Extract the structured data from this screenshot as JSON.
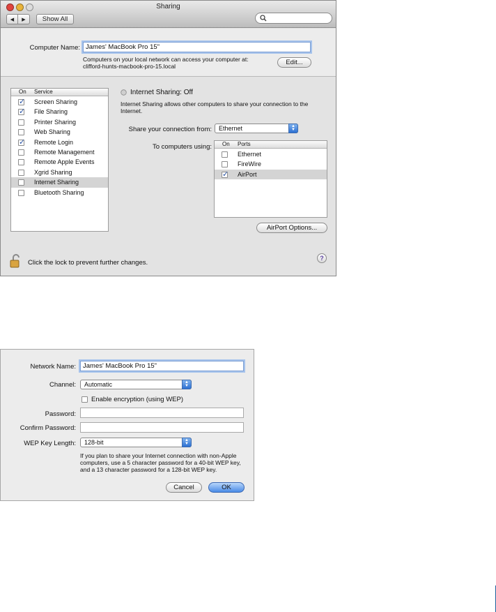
{
  "sharing_window": {
    "title": "Sharing",
    "nav_back": "◀",
    "nav_forward": "▶",
    "show_all": "Show All",
    "search_placeholder": "",
    "computer_name_label": "Computer Name:",
    "computer_name_value": "James' MacBook Pro 15\"",
    "network_info_line1": "Computers on your local network can access your computer at:",
    "network_info_line2": "clifford-hunts-macbook-pro-15.local",
    "edit_button": "Edit...",
    "service_list": {
      "col_on": "On",
      "col_service": "Service",
      "items": [
        {
          "label": "Screen Sharing",
          "checked": true,
          "selected": false
        },
        {
          "label": "File Sharing",
          "checked": true,
          "selected": false
        },
        {
          "label": "Printer Sharing",
          "checked": false,
          "selected": false
        },
        {
          "label": "Web Sharing",
          "checked": false,
          "selected": false
        },
        {
          "label": "Remote Login",
          "checked": true,
          "selected": false
        },
        {
          "label": "Remote Management",
          "checked": false,
          "selected": false
        },
        {
          "label": "Remote Apple Events",
          "checked": false,
          "selected": false
        },
        {
          "label": "Xgrid Sharing",
          "checked": false,
          "selected": false
        },
        {
          "label": "Internet Sharing",
          "checked": false,
          "selected": true
        },
        {
          "label": "Bluetooth Sharing",
          "checked": false,
          "selected": false
        }
      ]
    },
    "status_text": "Internet Sharing: Off",
    "description_line1": "Internet Sharing allows other computers to share your connection to the",
    "description_line2": "Internet.",
    "share_from_label": "Share your connection from:",
    "share_from_value": "Ethernet",
    "to_computers_label": "To computers using:",
    "ports_list": {
      "col_on": "On",
      "col_ports": "Ports",
      "items": [
        {
          "label": "Ethernet",
          "checked": false,
          "selected": false
        },
        {
          "label": "FireWire",
          "checked": false,
          "selected": false
        },
        {
          "label": "AirPort",
          "checked": true,
          "selected": true
        }
      ]
    },
    "airport_options_button": "AirPort Options...",
    "lock_text": "Click the lock to prevent further changes.",
    "help_button": "?"
  },
  "airport_sheet": {
    "network_name_label": "Network Name:",
    "network_name_value": "James' MacBook Pro 15\"",
    "channel_label": "Channel:",
    "channel_value": "Automatic",
    "encryption_label": "Enable encryption (using WEP)",
    "encryption_checked": false,
    "password_label": "Password:",
    "password_value": "",
    "confirm_password_label": "Confirm Password:",
    "confirm_password_value": "",
    "wep_key_length_label": "WEP Key Length:",
    "wep_key_length_value": "128-bit",
    "help_line1": "If you plan to share your Internet connection with non-Apple",
    "help_line2": "computers, use a 5 character password for a 40-bit WEP key,",
    "help_line3": "and a 13 character password for a 128-bit WEP key.",
    "cancel_button": "Cancel",
    "ok_button": "OK"
  },
  "colors": {
    "close": "#e0443e",
    "minimize": "#e8b33a",
    "zoom": "#dcdcdc",
    "accent": "#2c70d2",
    "check": "#2a54a4",
    "page_rule": "#1b5f9b"
  },
  "icons": {
    "search": "search-icon",
    "lock": "lock-icon",
    "help": "help-icon",
    "popup": "popup-arrows-icon",
    "status": "status-indicator-icon"
  }
}
